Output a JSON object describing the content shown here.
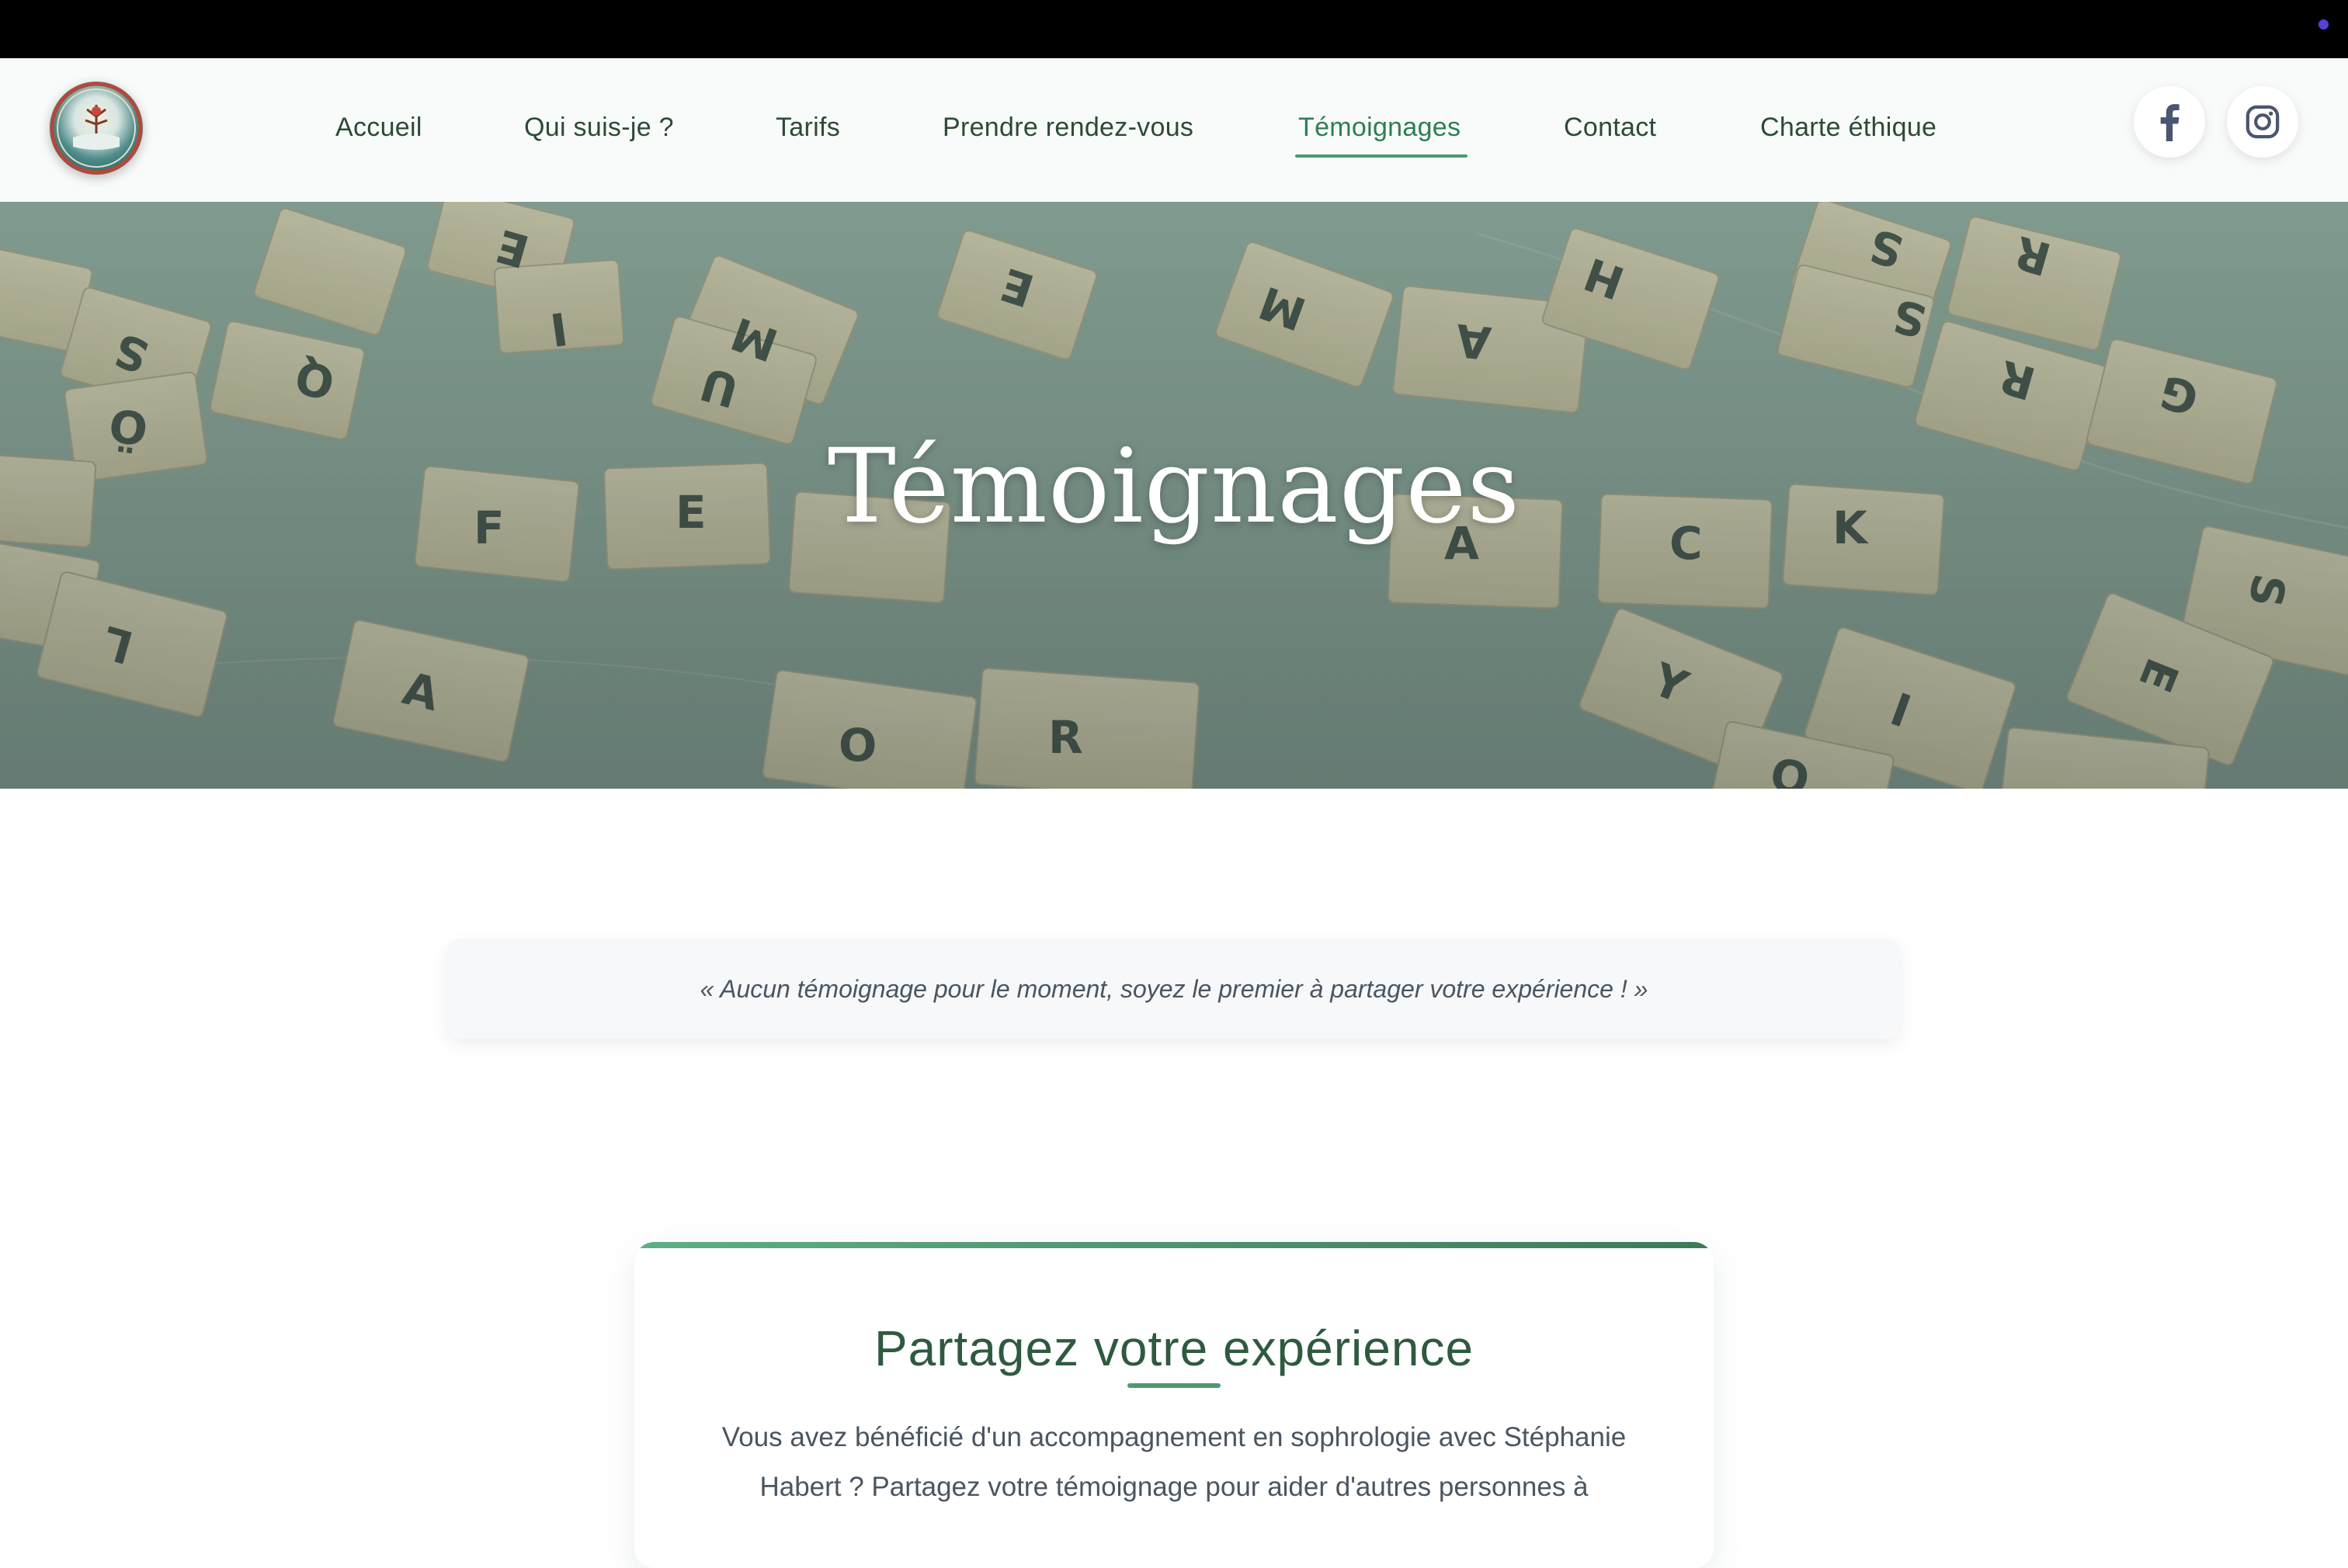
{
  "nav": {
    "items": [
      {
        "label": "Accueil"
      },
      {
        "label": "Qui suis-je ?"
      },
      {
        "label": "Tarifs"
      },
      {
        "label": "Prendre rendez-vous"
      },
      {
        "label": "Témoignages",
        "active": true
      },
      {
        "label": "Contact"
      },
      {
        "label": "Charte éthique"
      }
    ],
    "social": [
      "facebook-icon",
      "instagram-icon"
    ]
  },
  "hero": {
    "title": "Témoignages"
  },
  "notice": {
    "text": "« Aucun témoignage pour le moment, soyez le premier à partager votre expérience ! »"
  },
  "card": {
    "title": "Partagez votre expérience",
    "text": "Vous avez bénéficié d'un accompagnement en sophrologie avec Stéphanie Habert ? Partagez votre témoignage pour aider d'autres personnes à"
  },
  "colors": {
    "accent": "#4e9a72",
    "text_dark": "#2c4a35",
    "hero_text": "#ffffff"
  }
}
